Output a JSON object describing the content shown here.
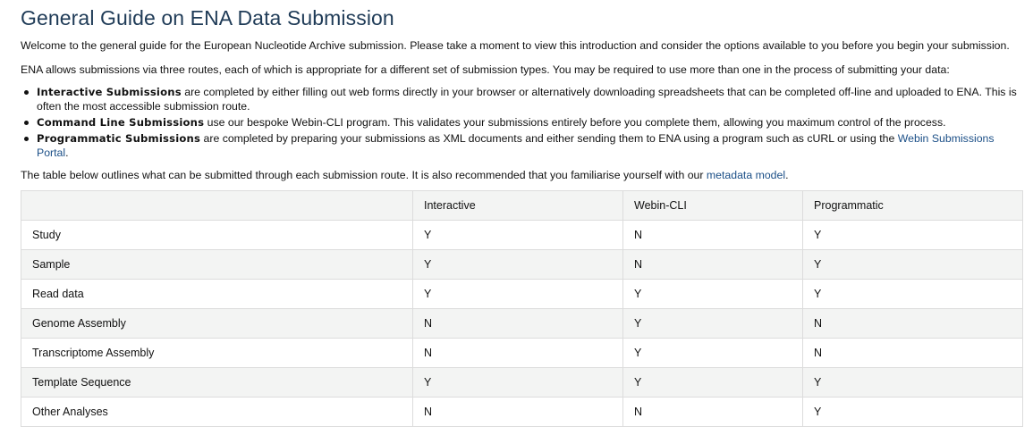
{
  "title": "General Guide on ENA Data Submission",
  "intro": "Welcome to the general guide for the European Nucleotide Archive submission. Please take a moment to view this introduction and consider the options available to you before you begin your submission.",
  "routes_text": "ENA allows submissions via three routes, each of which is appropriate for a different set of submission types. You may be required to use more than one in the process of submitting your data:",
  "bullets": [
    {
      "label": "Interactive Submissions",
      "text": " are completed by either filling out web forms directly in your browser or alternatively downloading spreadsheets that can be completed off-line and uploaded to ENA. This is often the most accessible submission route.",
      "link": "",
      "tail": ""
    },
    {
      "label": "Command Line Submissions",
      "text": " use our bespoke Webin-CLI program. This validates your submissions entirely before you complete them, allowing you maximum control of the process.",
      "link": "",
      "tail": ""
    },
    {
      "label": "Programmatic Submissions",
      "text": " are completed by preparing your submissions as XML documents and either sending them to ENA using a program such as cURL or using the ",
      "link": "Webin Submissions Portal",
      "tail": "."
    }
  ],
  "table_intro": {
    "text": "The table below outlines what can be submitted through each submission route. It is also recommended that you familiarise yourself with our ",
    "link": "metadata model",
    "tail": "."
  },
  "table": {
    "headers": [
      "",
      "Interactive",
      "Webin-CLI",
      "Programmatic"
    ],
    "rows": [
      [
        "Study",
        "Y",
        "N",
        "Y"
      ],
      [
        "Sample",
        "Y",
        "N",
        "Y"
      ],
      [
        "Read data",
        "Y",
        "Y",
        "Y"
      ],
      [
        "Genome Assembly",
        "N",
        "Y",
        "N"
      ],
      [
        "Transcriptome Assembly",
        "N",
        "Y",
        "N"
      ],
      [
        "Template Sequence",
        "Y",
        "Y",
        "Y"
      ],
      [
        "Other Analyses",
        "N",
        "N",
        "Y"
      ]
    ]
  },
  "colors": {
    "title": "#1f3b57",
    "link": "#1b4f87",
    "stripe": "#f3f4f3",
    "border": "#dcdcdc"
  }
}
